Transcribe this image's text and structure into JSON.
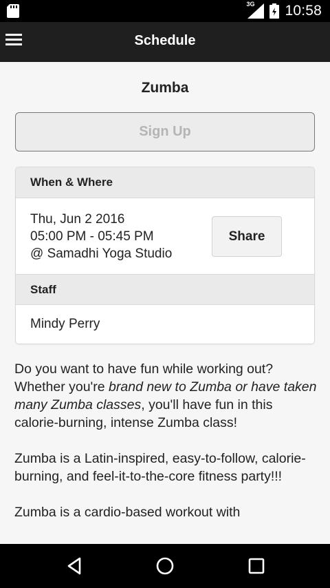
{
  "status_bar": {
    "network_label": "3G",
    "time": "10:58"
  },
  "app_bar": {
    "title": "Schedule"
  },
  "class": {
    "name": "Zumba",
    "signup_label": "Sign Up"
  },
  "when_where": {
    "header": "When & Where",
    "date": "Thu, Jun 2 2016",
    "time": "05:00 PM - 05:45 PM",
    "location": "@ Samadhi Yoga Studio",
    "share_label": "Share"
  },
  "staff": {
    "header": "Staff",
    "name": "Mindy Perry"
  },
  "description": {
    "p1_a": "Do you want to have fun while working out? Whether you're ",
    "p1_em": "brand new to Zumba or have taken many Zumba classes",
    "p1_b": ", you'll have fun in this calorie-burning, intense Zumba class!",
    "p2": "Zumba is a Latin-inspired, easy-to-follow, calorie-burning, and feel-it-to-the-core fitness party!!!",
    "p3": "Zumba is a cardio-based workout with"
  },
  "nav_bar": {
    "back_icon": "back-triangle-icon",
    "home_icon": "home-circle-icon",
    "recents_icon": "recents-square-icon"
  }
}
